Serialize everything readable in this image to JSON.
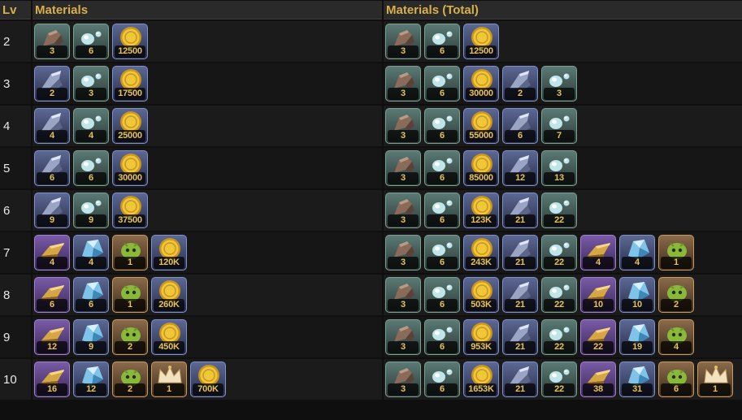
{
  "headers": {
    "lv": "Lv",
    "materials": "Materials",
    "total": "Materials (Total)"
  },
  "colors": {
    "header_text": "#d8b04a",
    "qty_text": "#e8c25a",
    "background": "#0f0f0f"
  },
  "rows": [
    {
      "lv": "2",
      "materials": [
        {
          "icon": "scrap-iron-icon",
          "rarity": "green",
          "qty": "3"
        },
        {
          "icon": "crystal-shard-icon",
          "rarity": "green",
          "qty": "6"
        },
        {
          "icon": "gold-coin-icon",
          "rarity": "blue",
          "qty": "12500"
        }
      ],
      "total": [
        {
          "icon": "scrap-iron-icon",
          "rarity": "green",
          "qty": "3"
        },
        {
          "icon": "crystal-shard-icon",
          "rarity": "green",
          "qty": "6"
        },
        {
          "icon": "gold-coin-icon",
          "rarity": "blue",
          "qty": "12500"
        }
      ]
    },
    {
      "lv": "3",
      "materials": [
        {
          "icon": "steel-ore-icon",
          "rarity": "blue",
          "qty": "2"
        },
        {
          "icon": "crystal-shard-icon",
          "rarity": "green",
          "qty": "3"
        },
        {
          "icon": "gold-coin-icon",
          "rarity": "blue",
          "qty": "17500"
        }
      ],
      "total": [
        {
          "icon": "scrap-iron-icon",
          "rarity": "green",
          "qty": "3"
        },
        {
          "icon": "crystal-shard-icon",
          "rarity": "green",
          "qty": "6"
        },
        {
          "icon": "gold-coin-icon",
          "rarity": "blue",
          "qty": "30000"
        },
        {
          "icon": "steel-ore-icon",
          "rarity": "blue",
          "qty": "2"
        },
        {
          "icon": "crystal-shard-icon",
          "rarity": "green",
          "qty": "3"
        }
      ]
    },
    {
      "lv": "4",
      "materials": [
        {
          "icon": "steel-ore-icon",
          "rarity": "blue",
          "qty": "4"
        },
        {
          "icon": "crystal-shard-icon",
          "rarity": "green",
          "qty": "4"
        },
        {
          "icon": "gold-coin-icon",
          "rarity": "blue",
          "qty": "25000"
        }
      ],
      "total": [
        {
          "icon": "scrap-iron-icon",
          "rarity": "green",
          "qty": "3"
        },
        {
          "icon": "crystal-shard-icon",
          "rarity": "green",
          "qty": "6"
        },
        {
          "icon": "gold-coin-icon",
          "rarity": "blue",
          "qty": "55000"
        },
        {
          "icon": "steel-ore-icon",
          "rarity": "blue",
          "qty": "6"
        },
        {
          "icon": "crystal-shard-icon",
          "rarity": "green",
          "qty": "7"
        }
      ]
    },
    {
      "lv": "5",
      "materials": [
        {
          "icon": "steel-ore-icon",
          "rarity": "blue",
          "qty": "6"
        },
        {
          "icon": "crystal-shard-icon",
          "rarity": "green",
          "qty": "6"
        },
        {
          "icon": "gold-coin-icon",
          "rarity": "blue",
          "qty": "30000"
        }
      ],
      "total": [
        {
          "icon": "scrap-iron-icon",
          "rarity": "green",
          "qty": "3"
        },
        {
          "icon": "crystal-shard-icon",
          "rarity": "green",
          "qty": "6"
        },
        {
          "icon": "gold-coin-icon",
          "rarity": "blue",
          "qty": "85000"
        },
        {
          "icon": "steel-ore-icon",
          "rarity": "blue",
          "qty": "12"
        },
        {
          "icon": "crystal-shard-icon",
          "rarity": "green",
          "qty": "13"
        }
      ]
    },
    {
      "lv": "6",
      "materials": [
        {
          "icon": "steel-ore-icon",
          "rarity": "blue",
          "qty": "9"
        },
        {
          "icon": "crystal-shard-icon",
          "rarity": "green",
          "qty": "9"
        },
        {
          "icon": "gold-coin-icon",
          "rarity": "blue",
          "qty": "37500"
        }
      ],
      "total": [
        {
          "icon": "scrap-iron-icon",
          "rarity": "green",
          "qty": "3"
        },
        {
          "icon": "crystal-shard-icon",
          "rarity": "green",
          "qty": "6"
        },
        {
          "icon": "gold-coin-icon",
          "rarity": "blue",
          "qty": "123K"
        },
        {
          "icon": "steel-ore-icon",
          "rarity": "blue",
          "qty": "21"
        },
        {
          "icon": "crystal-shard-icon",
          "rarity": "green",
          "qty": "22"
        }
      ]
    },
    {
      "lv": "7",
      "materials": [
        {
          "icon": "gold-ingot-icon",
          "rarity": "purple",
          "qty": "4"
        },
        {
          "icon": "blue-crystal-icon",
          "rarity": "blue",
          "qty": "4"
        },
        {
          "icon": "slime-core-icon",
          "rarity": "orange",
          "qty": "1"
        },
        {
          "icon": "gold-coin-icon",
          "rarity": "blue",
          "qty": "120K"
        }
      ],
      "total": [
        {
          "icon": "scrap-iron-icon",
          "rarity": "green",
          "qty": "3"
        },
        {
          "icon": "crystal-shard-icon",
          "rarity": "green",
          "qty": "6"
        },
        {
          "icon": "gold-coin-icon",
          "rarity": "blue",
          "qty": "243K"
        },
        {
          "icon": "steel-ore-icon",
          "rarity": "blue",
          "qty": "21"
        },
        {
          "icon": "crystal-shard-icon",
          "rarity": "green",
          "qty": "22"
        },
        {
          "icon": "gold-ingot-icon",
          "rarity": "purple",
          "qty": "4"
        },
        {
          "icon": "blue-crystal-icon",
          "rarity": "blue",
          "qty": "4"
        },
        {
          "icon": "slime-core-icon",
          "rarity": "orange",
          "qty": "1"
        }
      ]
    },
    {
      "lv": "8",
      "materials": [
        {
          "icon": "gold-ingot-icon",
          "rarity": "purple",
          "qty": "6"
        },
        {
          "icon": "blue-crystal-icon",
          "rarity": "blue",
          "qty": "6"
        },
        {
          "icon": "slime-core-icon",
          "rarity": "orange",
          "qty": "1"
        },
        {
          "icon": "gold-coin-icon",
          "rarity": "blue",
          "qty": "260K"
        }
      ],
      "total": [
        {
          "icon": "scrap-iron-icon",
          "rarity": "green",
          "qty": "3"
        },
        {
          "icon": "crystal-shard-icon",
          "rarity": "green",
          "qty": "6"
        },
        {
          "icon": "gold-coin-icon",
          "rarity": "blue",
          "qty": "503K"
        },
        {
          "icon": "steel-ore-icon",
          "rarity": "blue",
          "qty": "21"
        },
        {
          "icon": "crystal-shard-icon",
          "rarity": "green",
          "qty": "22"
        },
        {
          "icon": "gold-ingot-icon",
          "rarity": "purple",
          "qty": "10"
        },
        {
          "icon": "blue-crystal-icon",
          "rarity": "blue",
          "qty": "10"
        },
        {
          "icon": "slime-core-icon",
          "rarity": "orange",
          "qty": "2"
        }
      ]
    },
    {
      "lv": "9",
      "materials": [
        {
          "icon": "gold-ingot-icon",
          "rarity": "purple",
          "qty": "12"
        },
        {
          "icon": "blue-crystal-icon",
          "rarity": "blue",
          "qty": "9"
        },
        {
          "icon": "slime-core-icon",
          "rarity": "orange",
          "qty": "2"
        },
        {
          "icon": "gold-coin-icon",
          "rarity": "blue",
          "qty": "450K"
        }
      ],
      "total": [
        {
          "icon": "scrap-iron-icon",
          "rarity": "green",
          "qty": "3"
        },
        {
          "icon": "crystal-shard-icon",
          "rarity": "green",
          "qty": "6"
        },
        {
          "icon": "gold-coin-icon",
          "rarity": "blue",
          "qty": "953K"
        },
        {
          "icon": "steel-ore-icon",
          "rarity": "blue",
          "qty": "21"
        },
        {
          "icon": "crystal-shard-icon",
          "rarity": "green",
          "qty": "22"
        },
        {
          "icon": "gold-ingot-icon",
          "rarity": "purple",
          "qty": "22"
        },
        {
          "icon": "blue-crystal-icon",
          "rarity": "blue",
          "qty": "19"
        },
        {
          "icon": "slime-core-icon",
          "rarity": "orange",
          "qty": "4"
        }
      ]
    },
    {
      "lv": "10",
      "materials": [
        {
          "icon": "gold-ingot-icon",
          "rarity": "purple",
          "qty": "16"
        },
        {
          "icon": "blue-crystal-icon",
          "rarity": "blue",
          "qty": "12"
        },
        {
          "icon": "slime-core-icon",
          "rarity": "orange",
          "qty": "2"
        },
        {
          "icon": "crown-icon",
          "rarity": "orange",
          "qty": "1"
        },
        {
          "icon": "gold-coin-icon",
          "rarity": "blue",
          "qty": "700K"
        }
      ],
      "total": [
        {
          "icon": "scrap-iron-icon",
          "rarity": "green",
          "qty": "3"
        },
        {
          "icon": "crystal-shard-icon",
          "rarity": "green",
          "qty": "6"
        },
        {
          "icon": "gold-coin-icon",
          "rarity": "blue",
          "qty": "1653K"
        },
        {
          "icon": "steel-ore-icon",
          "rarity": "blue",
          "qty": "21"
        },
        {
          "icon": "crystal-shard-icon",
          "rarity": "green",
          "qty": "22"
        },
        {
          "icon": "gold-ingot-icon",
          "rarity": "purple",
          "qty": "38"
        },
        {
          "icon": "blue-crystal-icon",
          "rarity": "blue",
          "qty": "31"
        },
        {
          "icon": "slime-core-icon",
          "rarity": "orange",
          "qty": "6"
        },
        {
          "icon": "crown-icon",
          "rarity": "orange",
          "qty": "1"
        }
      ]
    }
  ]
}
